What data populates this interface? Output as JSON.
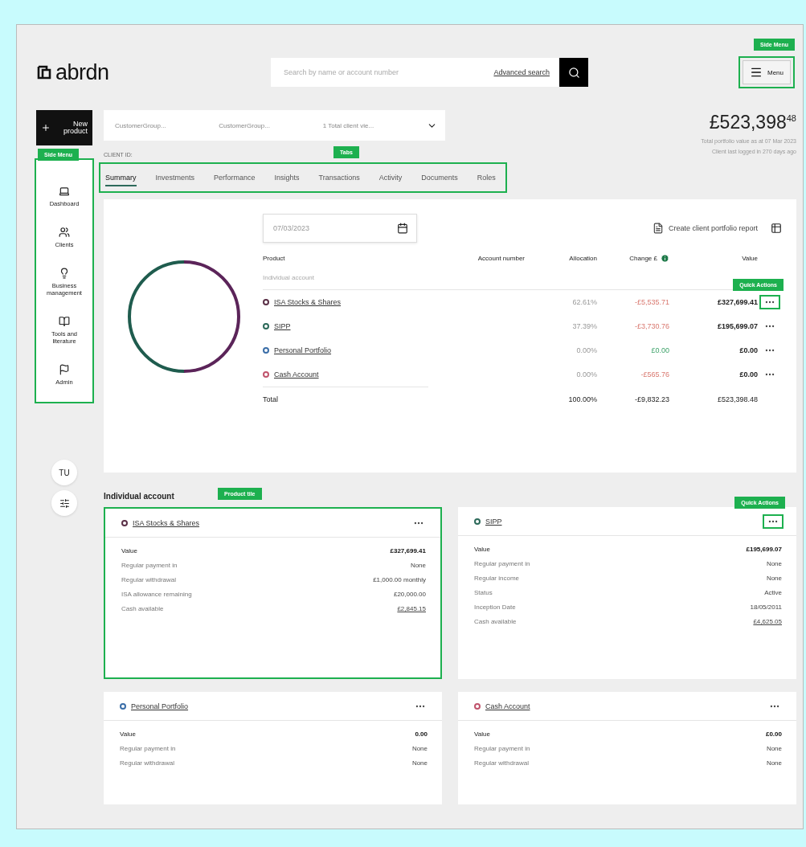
{
  "header": {
    "logo": "abrdn",
    "search": {
      "placeholder": "Search by name or account number"
    },
    "advanced_search": "Advanced search",
    "menu_button": {
      "label": "Menu",
      "annotation": "Side Menu"
    }
  },
  "sidebar": {
    "new_product": "New product",
    "annotation": "Side Menu",
    "items": [
      {
        "label": "Dashboard",
        "selected": false
      },
      {
        "label": "Clients",
        "selected": false
      },
      {
        "label": "Business management",
        "selected": false
      },
      {
        "label": "Tools and literature",
        "selected": false
      },
      {
        "label": "Admin",
        "selected": false
      }
    ],
    "avatar": "TU"
  },
  "client_selector": {
    "fields": [
      "CustomerGroup...",
      "CustomerGroup...",
      "1 Total client vie..."
    ]
  },
  "client_id_label": "CLIENT ID:",
  "portfolio": {
    "total": "£523,398$^{48}$",
    "as_at": "Total portfolio value as at 07 Mar 2023",
    "last_login": "Client last logged in 270 days ago"
  },
  "tabs": {
    "annotation": "Tabs",
    "items": [
      {
        "label": "Summary",
        "selected": true
      },
      {
        "label": "Investments",
        "selected": false
      },
      {
        "label": "Performance",
        "selected": false
      },
      {
        "label": "Insights",
        "selected": false
      },
      {
        "label": "Transactions",
        "selected": false
      },
      {
        "label": "Activity",
        "selected": false
      },
      {
        "label": "Documents",
        "selected": false
      },
      {
        "label": "Roles",
        "selected": false
      }
    ]
  },
  "summary": {
    "date": "07/03/2023",
    "report_link": "Create client portfolio report",
    "columns": [
      "Product",
      "Account number",
      "Allocation",
      "Change £",
      "Value"
    ],
    "group": "Individual account",
    "rows": [
      {
        "product": "ISA Stocks & Shares",
        "color": "#5b3148",
        "allocation": "62.61%",
        "change": "-£5,535.71",
        "negative": true,
        "value": "£327,699.41",
        "annotation": "Quick Actions"
      },
      {
        "product": "SIPP",
        "color": "#2d6a5a",
        "allocation": "37.39%",
        "change": "-£3,730.76",
        "negative": true,
        "value": "£195,699.07"
      },
      {
        "product": "Personal Portfolio",
        "color": "#3b6ea8",
        "allocation": "0.00%",
        "change": "£0.00",
        "negative": false,
        "value": "£0.00"
      },
      {
        "product": "Cash Account",
        "color": "#c0546c",
        "allocation": "0.00%",
        "change": "-£565.76",
        "negative": true,
        "value": "£0.00"
      }
    ],
    "total": {
      "label": "Total",
      "allocation": "100.00%",
      "change": "-£9,832.23",
      "value": "£523,398.48"
    }
  },
  "section_title": "Individual account",
  "tiles": [
    {
      "title": "ISA Stocks & Shares",
      "color": "#5b3148",
      "annotation": "Product tile",
      "rows": [
        {
          "label": "Value",
          "value": "£327,699.41",
          "kind": "value"
        },
        {
          "label": "Regular payment in",
          "value": "None",
          "kind": "plain"
        },
        {
          "label": "Regular withdrawal",
          "value": "£1,000.00 monthly",
          "kind": "plain"
        },
        {
          "label": "ISA allowance remaining",
          "value": "£20,000.00",
          "kind": "plain"
        },
        {
          "label": "Cash available",
          "value": "£2,845.15",
          "kind": "link"
        }
      ]
    },
    {
      "title": "SIPP",
      "color": "#2d6a5a",
      "quick_annotation": "Quick Actions",
      "rows": [
        {
          "label": "Value",
          "value": "£195,699.07",
          "kind": "value"
        },
        {
          "label": "Regular payment in",
          "value": "None",
          "kind": "plain"
        },
        {
          "label": "Regular income",
          "value": "None",
          "kind": "plain"
        },
        {
          "label": "Status",
          "value": "Active",
          "kind": "plain"
        },
        {
          "label": "Inception Date",
          "value": "18/05/2011",
          "kind": "plain"
        },
        {
          "label": "Cash available",
          "value": "£4,625.05",
          "kind": "link"
        }
      ]
    },
    {
      "title": "Personal Portfolio",
      "color": "#3b6ea8",
      "rows": [
        {
          "label": "Value",
          "value": "0.00",
          "kind": "value"
        },
        {
          "label": "Regular payment in",
          "value": "None",
          "kind": "plain"
        },
        {
          "label": "Regular withdrawal",
          "value": "None",
          "kind": "plain"
        }
      ]
    },
    {
      "title": "Cash Account",
      "color": "#c0546c",
      "rows": [
        {
          "label": "Value",
          "value": "£0.00",
          "kind": "value"
        },
        {
          "label": "Regular payment in",
          "value": "None",
          "kind": "plain"
        },
        {
          "label": "Regular withdrawal",
          "value": "None",
          "kind": "plain"
        }
      ]
    }
  ]
}
